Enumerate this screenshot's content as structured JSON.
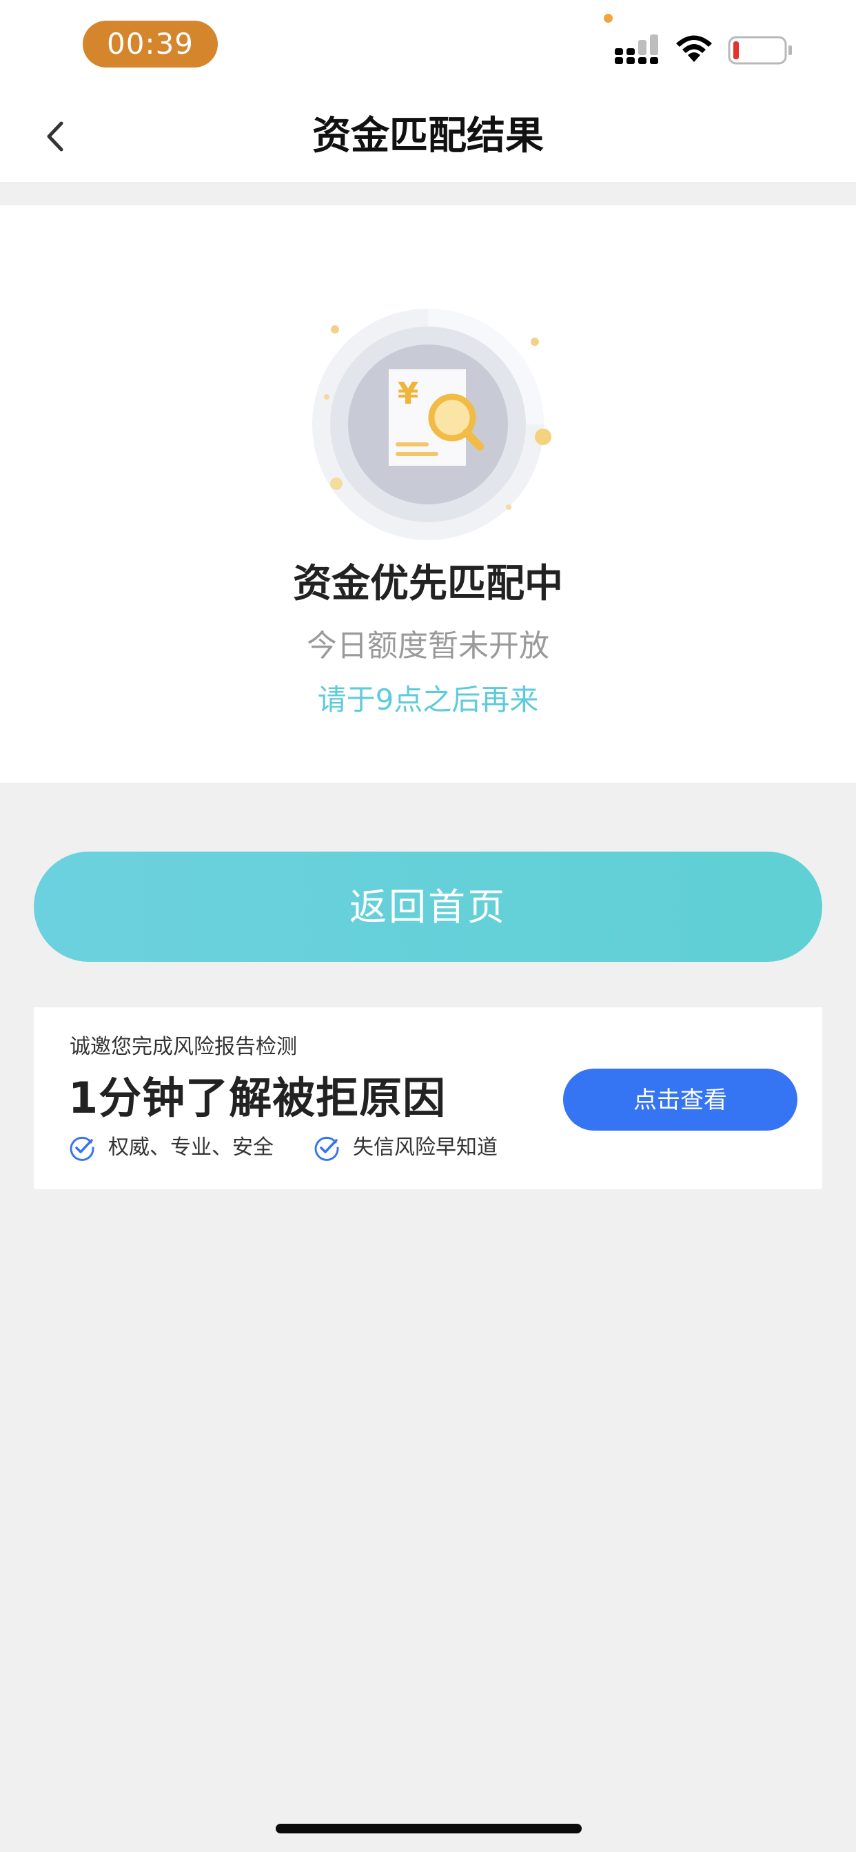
{
  "status_bar": {
    "time": "00:39",
    "icons": [
      "signal-icon",
      "wifi-icon",
      "battery-icon"
    ],
    "time_pill_color": "#d5852b"
  },
  "nav": {
    "title": "资金匹配结果",
    "back_icon": "chevron-left-icon"
  },
  "result": {
    "icon": "document-search-icon",
    "title": "资金优先匹配中",
    "subtitle": "今日额度暂未开放",
    "hint": "请于9点之后再来",
    "hint_color": "#5ecbdb"
  },
  "home_button": {
    "label": "返回首页",
    "color": "#62cfd8"
  },
  "report": {
    "invite": "诚邀您完成风险报告检测",
    "headline": "1分钟了解被拒原因",
    "features": [
      "权威、专业、安全",
      "失信风险早知道"
    ],
    "button_label": "点击查看",
    "button_color": "#3574f2"
  }
}
